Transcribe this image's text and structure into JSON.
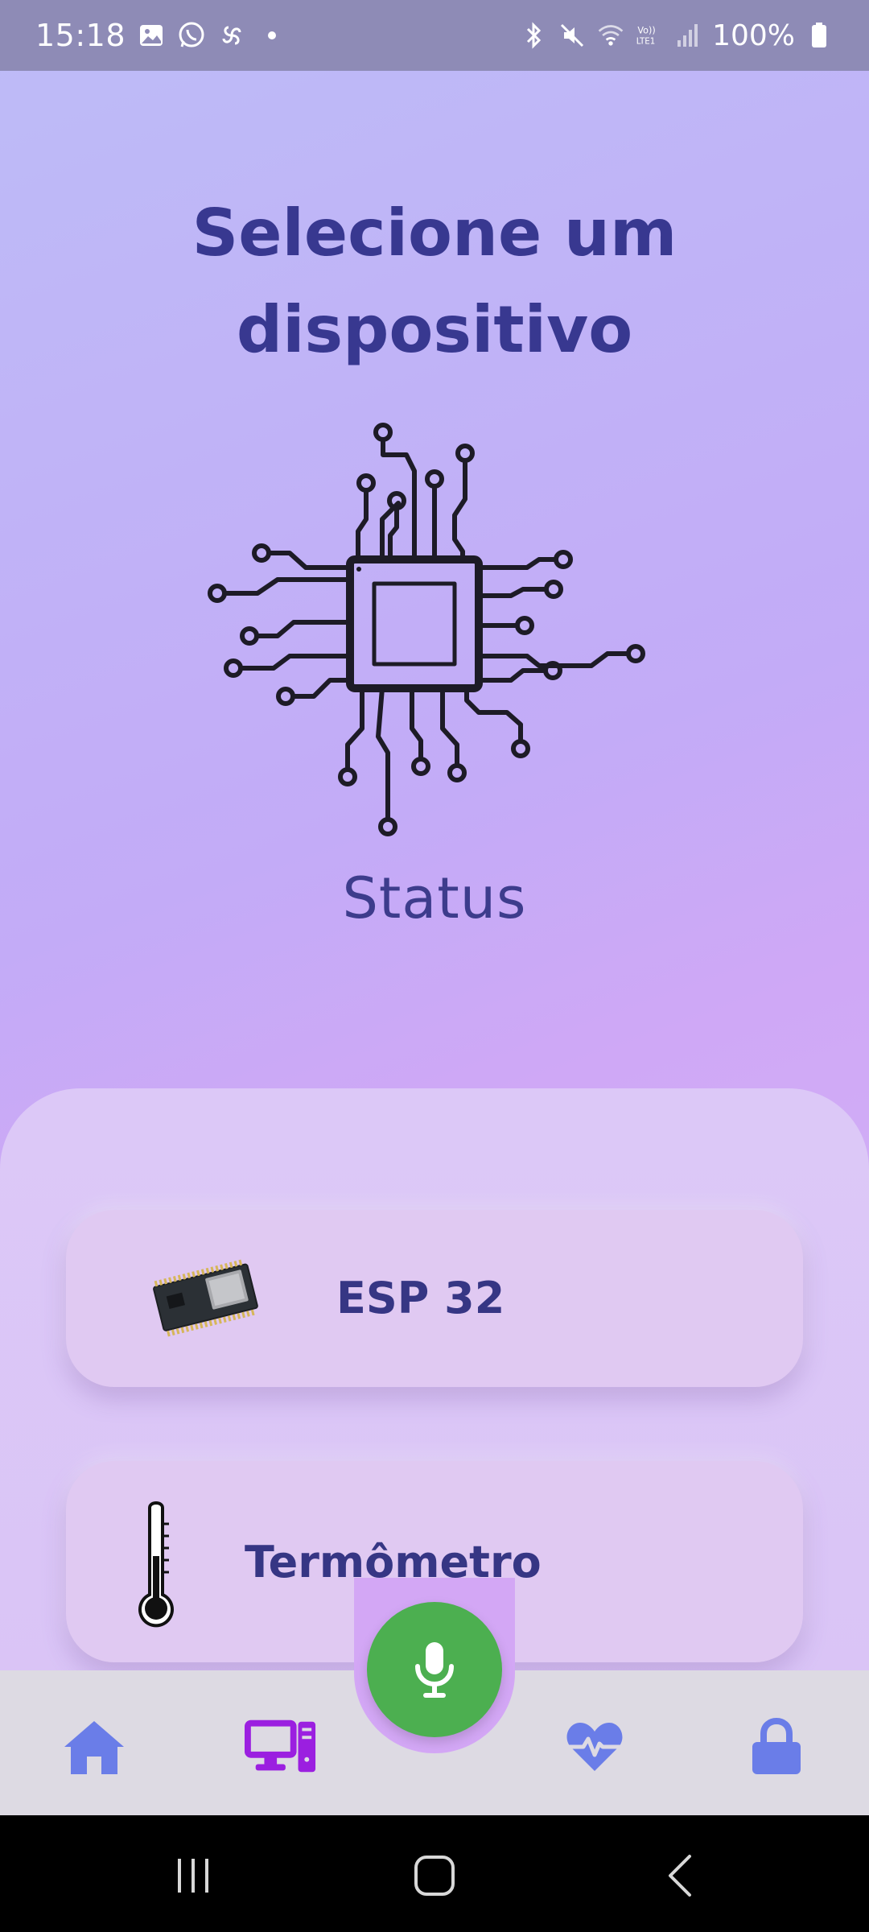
{
  "status_bar": {
    "time": "15:18",
    "battery": "100%",
    "left_icons": [
      "gallery-icon",
      "whatsapp-icon",
      "pinwheel-icon",
      "dot-icon"
    ],
    "right_icons": [
      "bluetooth-icon",
      "mute-icon",
      "wifi-icon",
      "volte-icon",
      "signal-icon",
      "battery-icon"
    ]
  },
  "header": {
    "title_line1": "Selecione um",
    "title_line2": "dispositivo"
  },
  "hero": {
    "icon": "circuit-chip-icon",
    "status_label": "Status"
  },
  "devices": [
    {
      "label": "ESP 32",
      "icon": "esp32-board-icon"
    },
    {
      "label": "Termômetro",
      "icon": "thermometer-icon"
    }
  ],
  "bottom_nav": {
    "items": [
      {
        "name": "home",
        "icon": "home-icon",
        "active": false
      },
      {
        "name": "devices",
        "icon": "devices-icon",
        "active": true
      },
      {
        "name": "health",
        "icon": "heart-pulse-icon",
        "active": false
      },
      {
        "name": "lock",
        "icon": "lock-icon",
        "active": false
      }
    ],
    "center_action_icon": "microphone-icon"
  },
  "colors": {
    "title": "#383890",
    "nav_active": "#9b1fe0",
    "nav_inactive": "#6a7de8",
    "mic_button": "#4caf50",
    "card_bg": "#e0c9f2"
  }
}
